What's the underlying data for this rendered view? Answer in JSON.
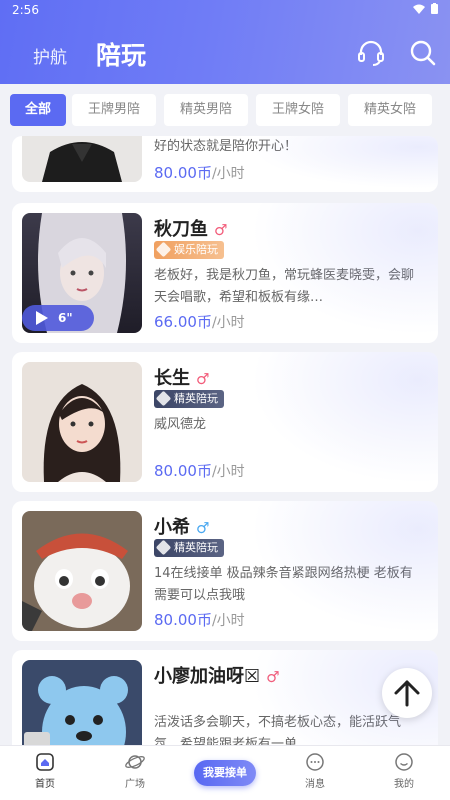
{
  "status_bar": {
    "time": "2:56"
  },
  "header": {
    "tabs": [
      {
        "label": "护航"
      },
      {
        "label": "陪玩"
      }
    ]
  },
  "filters": [
    {
      "label": "全部",
      "active": true
    },
    {
      "label": "王牌男陪",
      "active": false
    },
    {
      "label": "精英男陪",
      "active": false
    },
    {
      "label": "王牌女陪",
      "active": false
    },
    {
      "label": "精英女陪",
      "active": false
    }
  ],
  "cards": [
    {
      "name": "",
      "gender": "",
      "badge": "",
      "desc": "好的状态就是陪你开心！",
      "price": "80.00币",
      "unit": "/小时"
    },
    {
      "name": "秋刀鱼",
      "gender": "♂",
      "badge": "娱乐陪玩",
      "desc": "老板好，我是秋刀鱼，常玩蜂医麦晓雯，会聊天会唱歌，希望和板板有缘…",
      "price": "66.00币",
      "unit": "/小时",
      "video_duration": "6\""
    },
    {
      "name": "长生",
      "gender": "♂",
      "badge": "精英陪玩",
      "desc": "威风德龙",
      "price": "80.00币",
      "unit": "/小时"
    },
    {
      "name": "小希",
      "gender": "♂",
      "badge": "精英陪玩",
      "desc": "14在线接单 极品辣条音紧跟网络热梗 老板有需要可以点我哦",
      "price": "80.00币",
      "unit": "/小时"
    },
    {
      "name": "小廖加油呀☒",
      "gender": "♂",
      "badge": "",
      "desc": "活泼话多会聊天，不搞老板心态，能活跃气氛，希望能跟老板有一单",
      "price": "",
      "unit": ""
    }
  ],
  "bottom_nav": {
    "home": "首页",
    "square": "广场",
    "order": "我要接单",
    "messages": "消息",
    "me": "我的"
  },
  "colors": {
    "accent": "#5b6af2",
    "male_pink": "#f25c7a",
    "male_blue": "#4aa8f0"
  }
}
